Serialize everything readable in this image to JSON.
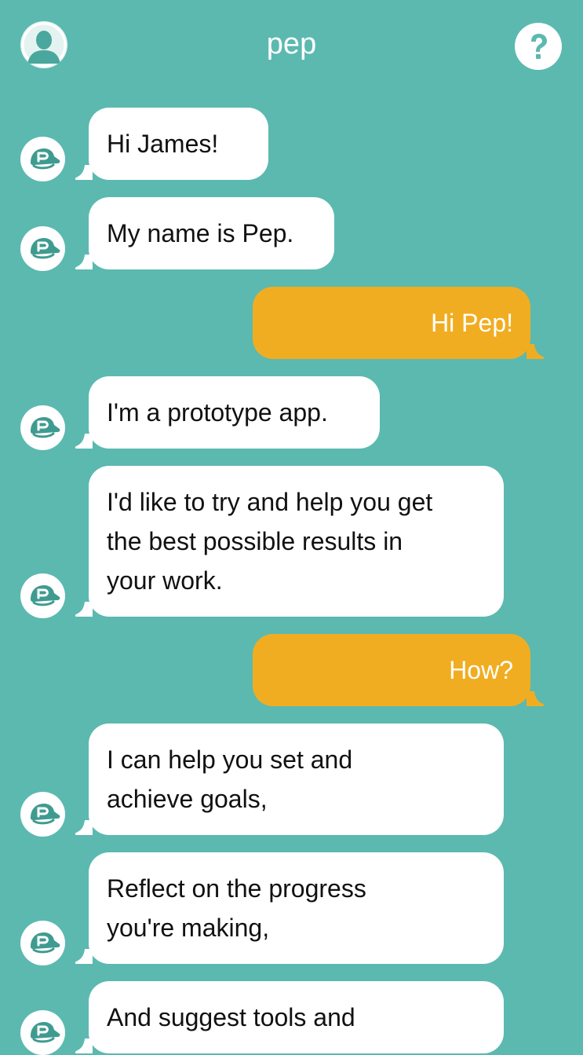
{
  "app": {
    "title": "pep"
  },
  "header": {
    "profile_icon": "user-silhouette-icon",
    "help_icon": "question-mark-icon"
  },
  "colors": {
    "background": "#5bb9b0",
    "bot_bubble": "#ffffff",
    "user_bubble": "#f1ad21",
    "bot_text": "#111111",
    "user_text": "#ffffff",
    "avatar_icon": "#3f9b90"
  },
  "bot_avatar_icon": "pep-cap-logo-icon",
  "messages": [
    {
      "sender": "bot",
      "lines": [
        "Hi James!"
      ]
    },
    {
      "sender": "bot",
      "lines": [
        "My name is Pep."
      ]
    },
    {
      "sender": "user",
      "lines": [
        "Hi Pep!"
      ]
    },
    {
      "sender": "bot",
      "lines": [
        "I'm a prototype app."
      ]
    },
    {
      "sender": "bot",
      "lines": [
        "I'd like to try and help you get",
        "the best possible results in",
        "your work."
      ]
    },
    {
      "sender": "user",
      "lines": [
        "How?"
      ]
    },
    {
      "sender": "bot",
      "lines": [
        "I can help you set and",
        "achieve goals,"
      ]
    },
    {
      "sender": "bot",
      "lines": [
        "Reflect on the progress",
        "you're making,"
      ]
    },
    {
      "sender": "bot",
      "lines": [
        "And suggest tools and"
      ]
    }
  ]
}
